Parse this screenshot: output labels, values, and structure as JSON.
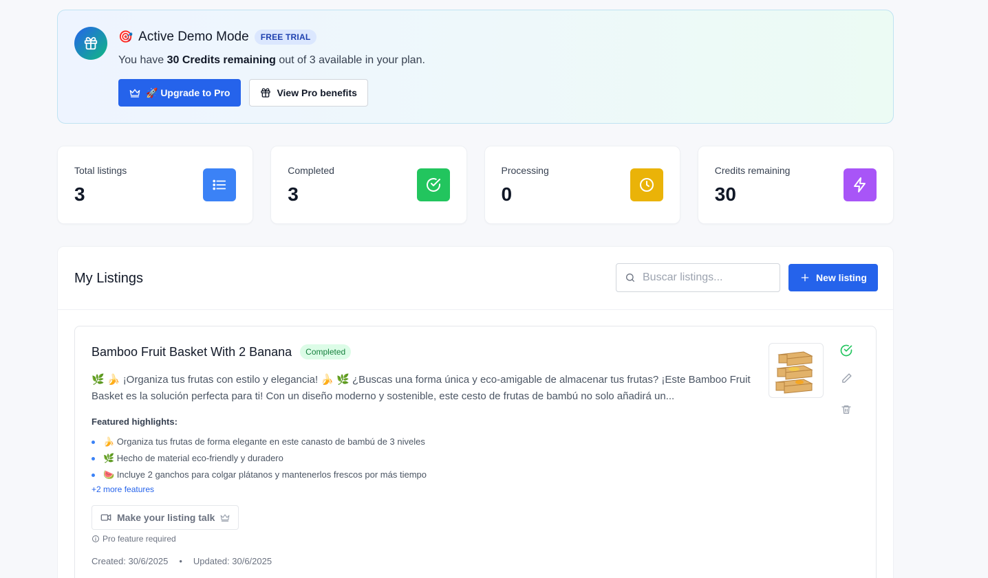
{
  "banner": {
    "emoji": "🎯",
    "title": "Active Demo Mode",
    "badge": "FREE TRIAL",
    "text_prefix": "You have ",
    "text_bold": "30 Credits remaining",
    "text_suffix": " out of 3 available in your plan.",
    "upgrade_label": "🚀 Upgrade to Pro",
    "benefits_label": "View Pro benefits",
    "icon": "gift-icon"
  },
  "stats": [
    {
      "label": "Total listings",
      "value": "3",
      "icon": "list-icon",
      "color": "#3b82f6"
    },
    {
      "label": "Completed",
      "value": "3",
      "icon": "check-circle-icon",
      "color": "#22c55e"
    },
    {
      "label": "Processing",
      "value": "0",
      "icon": "clock-icon",
      "color": "#eab308"
    },
    {
      "label": "Credits remaining",
      "value": "30",
      "icon": "lightning-icon",
      "color": "#a855f7"
    }
  ],
  "listings": {
    "title": "My Listings",
    "search_placeholder": "Buscar listings...",
    "new_label": "New listing",
    "items": [
      {
        "title": "Bamboo Fruit Basket With 2 Banana",
        "status": "Completed",
        "description": "🌿 🍌 ¡Organiza tus frutas con estilo y elegancia! 🍌 🌿 ¿Buscas una forma única y eco-amigable de almacenar tus frutas? ¡Este Bamboo Fruit Basket es la solución perfecta para ti! Con un diseño moderno y sostenible, este cesto de frutas de bambú no solo añadirá un...",
        "highlights_title": "Featured highlights:",
        "highlights": [
          "🍌 Organiza tus frutas de forma elegante en este canasto de bambú de 3 niveles",
          "🌿 Hecho de material eco-friendly y duradero",
          "🍉 Incluye 2 ganchos para colgar plátanos y mantenerlos frescos por más tiempo"
        ],
        "more_features": "+2 more features",
        "talk_label": "Make your listing talk",
        "pro_required": "Pro feature required",
        "created": "Created: 30/6/2025",
        "separator": "•",
        "updated": "Updated: 30/6/2025"
      }
    ]
  },
  "colors": {
    "primary": "#2563eb",
    "success": "#22c55e",
    "warning": "#eab308",
    "purple": "#a855f7"
  }
}
